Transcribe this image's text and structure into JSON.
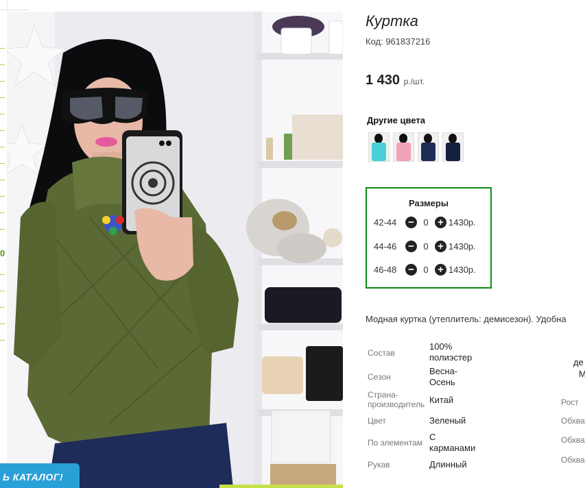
{
  "product": {
    "title": "Куртка",
    "code": "Код: 961837216",
    "price": "1 430",
    "price_unit": "р./шт."
  },
  "other_colors": {
    "heading": "Другие цвета",
    "swatches": [
      "#48d0d8",
      "#f2a2b8",
      "#1f2c55",
      "#162040"
    ]
  },
  "sizes": {
    "heading": "Размеры",
    "rows": [
      {
        "size": "42-44",
        "qty": "0",
        "price": "1430р."
      },
      {
        "size": "44-46",
        "qty": "0",
        "price": "1430р."
      },
      {
        "size": "46-48",
        "qty": "0",
        "price": "1430р."
      }
    ],
    "minus": "−",
    "plus": "+"
  },
  "description": "Модная куртка (утеплитель: демисезон). Удобна",
  "specs": [
    {
      "label": "Состав",
      "value": "100% полиэстер"
    },
    {
      "label": "Сезон",
      "value": "Весна-Осень"
    },
    {
      "label": "Страна-производитель",
      "value": "Китай"
    },
    {
      "label": "Цвет",
      "value": "Зеленый"
    },
    {
      "label": "По элементам",
      "value": "С карманами"
    },
    {
      "label": "Рукав",
      "value": "Длинный"
    }
  ],
  "right_column": {
    "top_1": "де",
    "top_2": "М",
    "labels": [
      "Рост",
      "Обхва",
      "Обхва",
      "Обхва"
    ]
  },
  "left_edge": {
    "digit": "0",
    "catalog_button": "Ь КАТАЛОГ!"
  },
  "colors": {
    "sizes_border": "#0a8a16",
    "catalog_button": "#2aa0d8",
    "jacket": "#5b6a35"
  }
}
